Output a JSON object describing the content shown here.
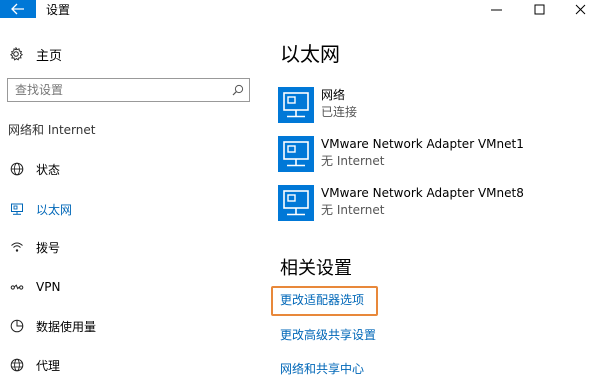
{
  "window": {
    "title": "设置",
    "accent_color": "#0078d7",
    "highlight_color": "#e8883a"
  },
  "sidebar": {
    "home_label": "主页",
    "home_icon": "gear-icon",
    "search_placeholder": "查找设置",
    "search_icon": "search-icon",
    "section_heading": "网络和 Internet",
    "items": [
      {
        "label": "状态",
        "icon": "globe-icon",
        "active": false
      },
      {
        "label": "以太网",
        "icon": "ethernet-icon",
        "active": true
      },
      {
        "label": "拨号",
        "icon": "dialup-icon",
        "active": false
      },
      {
        "label": "VPN",
        "icon": "vpn-icon",
        "active": false
      },
      {
        "label": "数据使用量",
        "icon": "data-usage-icon",
        "active": false
      },
      {
        "label": "代理",
        "icon": "proxy-globe-icon",
        "active": false
      }
    ]
  },
  "main": {
    "title": "以太网",
    "adapters": [
      {
        "name": "网络",
        "status": "已连接",
        "icon": "ethernet-adapter-icon"
      },
      {
        "name": "VMware Network Adapter VMnet1",
        "status": "无 Internet",
        "icon": "ethernet-adapter-icon"
      },
      {
        "name": "VMware Network Adapter VMnet8",
        "status": "无 Internet",
        "icon": "ethernet-adapter-icon"
      }
    ],
    "related_title": "相关设置",
    "related_links": [
      {
        "label": "更改适配器选项",
        "highlighted": true
      },
      {
        "label": "更改高级共享设置",
        "highlighted": false
      },
      {
        "label": "网络和共享中心",
        "highlighted": false
      }
    ]
  }
}
